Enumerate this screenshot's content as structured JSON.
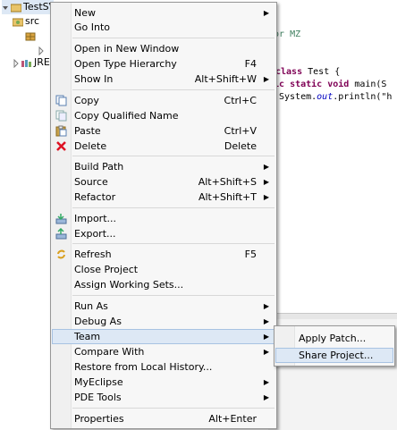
{
  "tree": {
    "project_label": "TestSV",
    "src_label": "src",
    "jre_label": "JRE"
  },
  "editor": {
    "line1": "nor MZ",
    "line2_kw": "class",
    "line2_rest": " Test {",
    "line3_kw": "lic static void",
    "line3_rest": " main(S",
    "line4_a": "System.",
    "line4_fld": "out",
    "line4_b": ".println(\"h"
  },
  "menu": {
    "items": [
      {
        "label": "New",
        "accel": "",
        "submenu": true,
        "icon": ""
      },
      {
        "label": "Go Into",
        "accel": "",
        "submenu": false,
        "icon": ""
      },
      {
        "label": "Open in New Window",
        "accel": "",
        "submenu": false,
        "icon": ""
      },
      {
        "label": "Open Type Hierarchy",
        "accel": "F4",
        "submenu": false,
        "icon": ""
      },
      {
        "label": "Show In",
        "accel": "Alt+Shift+W",
        "submenu": true,
        "icon": ""
      },
      {
        "label": "Copy",
        "accel": "Ctrl+C",
        "submenu": false,
        "icon": "copy-icon"
      },
      {
        "label": "Copy Qualified Name",
        "accel": "",
        "submenu": false,
        "icon": "copy-qualified-icon"
      },
      {
        "label": "Paste",
        "accel": "Ctrl+V",
        "submenu": false,
        "icon": "paste-icon"
      },
      {
        "label": "Delete",
        "accel": "Delete",
        "submenu": false,
        "icon": "delete-icon"
      },
      {
        "label": "Build Path",
        "accel": "",
        "submenu": true,
        "icon": ""
      },
      {
        "label": "Source",
        "accel": "Alt+Shift+S",
        "submenu": true,
        "icon": ""
      },
      {
        "label": "Refactor",
        "accel": "Alt+Shift+T",
        "submenu": true,
        "icon": ""
      },
      {
        "label": "Import...",
        "accel": "",
        "submenu": false,
        "icon": "import-icon"
      },
      {
        "label": "Export...",
        "accel": "",
        "submenu": false,
        "icon": "export-icon"
      },
      {
        "label": "Refresh",
        "accel": "F5",
        "submenu": false,
        "icon": "refresh-icon"
      },
      {
        "label": "Close Project",
        "accel": "",
        "submenu": false,
        "icon": ""
      },
      {
        "label": "Assign Working Sets...",
        "accel": "",
        "submenu": false,
        "icon": ""
      },
      {
        "label": "Run As",
        "accel": "",
        "submenu": true,
        "icon": ""
      },
      {
        "label": "Debug As",
        "accel": "",
        "submenu": true,
        "icon": ""
      },
      {
        "label": "Team",
        "accel": "",
        "submenu": true,
        "icon": "",
        "hover": true
      },
      {
        "label": "Compare With",
        "accel": "",
        "submenu": true,
        "icon": ""
      },
      {
        "label": "Restore from Local History...",
        "accel": "",
        "submenu": false,
        "icon": ""
      },
      {
        "label": "MyEclipse",
        "accel": "",
        "submenu": true,
        "icon": ""
      },
      {
        "label": "PDE Tools",
        "accel": "",
        "submenu": true,
        "icon": ""
      },
      {
        "label": "Properties",
        "accel": "Alt+Enter",
        "submenu": false,
        "icon": ""
      }
    ]
  },
  "team_submenu": {
    "items": [
      {
        "label": "Apply Patch...",
        "hover": false
      },
      {
        "label": "Share Project...",
        "hover": true
      }
    ]
  },
  "colors": {
    "menu_bg": "#f7f7f7",
    "hover_bg": "#dde8f5",
    "hover_border": "#a8c3e2",
    "keyword": "#7f0055"
  }
}
